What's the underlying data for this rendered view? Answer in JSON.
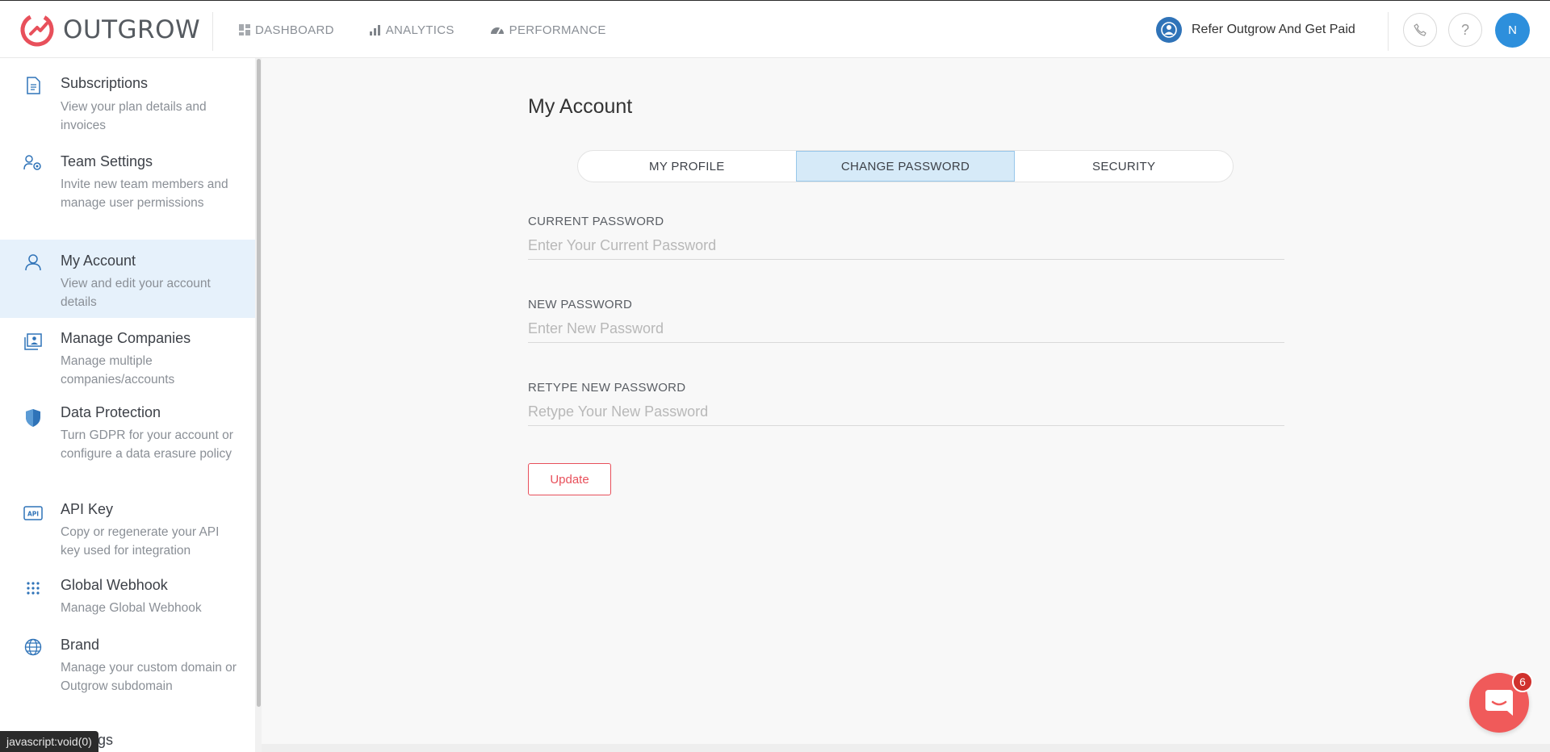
{
  "header": {
    "logo_text": "OUTGROW",
    "nav": [
      {
        "label": "DASHBOARD",
        "icon": "dashboard-icon"
      },
      {
        "label": "ANALYTICS",
        "icon": "analytics-icon"
      },
      {
        "label": "PERFORMANCE",
        "icon": "performance-icon"
      }
    ],
    "refer_label": "Refer Outgrow And Get Paid",
    "phone_icon": "phone-icon",
    "help_label": "?",
    "avatar_initial": "N"
  },
  "sidebar": {
    "items": [
      {
        "title": "Subscriptions",
        "desc": "View your plan details and invoices",
        "icon": "document-icon"
      },
      {
        "title": "Team Settings",
        "desc": "Invite new team members and manage user permissions",
        "icon": "team-gear-icon"
      },
      {
        "title": "My Account",
        "desc": "View and edit your account details",
        "icon": "user-icon",
        "active": true
      },
      {
        "title": "Manage Companies",
        "desc": "Manage multiple companies/accounts",
        "icon": "companies-icon"
      },
      {
        "title": "Data Protection",
        "desc": "Turn GDPR for your account or configure a data erasure policy",
        "icon": "shield-icon"
      },
      {
        "title": "API Key",
        "desc": "Copy or regenerate your API key used for integration",
        "icon": "api-icon"
      },
      {
        "title": "Global Webhook",
        "desc": "Manage Global Webhook",
        "icon": "webhook-icon"
      },
      {
        "title": "Brand",
        "desc": "Manage your custom domain or Outgrow subdomain",
        "icon": "globe-icon"
      },
      {
        "title": "Settings",
        "desc": "",
        "icon": "settings-icon"
      }
    ]
  },
  "main": {
    "title": "My Account",
    "tabs": [
      {
        "label": "MY PROFILE"
      },
      {
        "label": "CHANGE PASSWORD",
        "active": true
      },
      {
        "label": "SECURITY"
      }
    ],
    "fields": [
      {
        "label": "CURRENT PASSWORD",
        "placeholder": "Enter Your Current Password",
        "value": ""
      },
      {
        "label": "NEW PASSWORD",
        "placeholder": "Enter New Password",
        "value": ""
      },
      {
        "label": "RETYPE NEW PASSWORD",
        "placeholder": "Retype Your New Password",
        "value": ""
      }
    ],
    "update_label": "Update"
  },
  "chat": {
    "badge_count": "6",
    "icon": "chat-icon"
  },
  "status_bar_text": "javascript:void(0)",
  "colors": {
    "accent_red": "#e8505b",
    "active_bg": "#e6f1fb",
    "tab_active_bg": "#d6eaf8",
    "avatar_blue": "#2d8fdc",
    "icon_blue": "#2f73b8"
  }
}
